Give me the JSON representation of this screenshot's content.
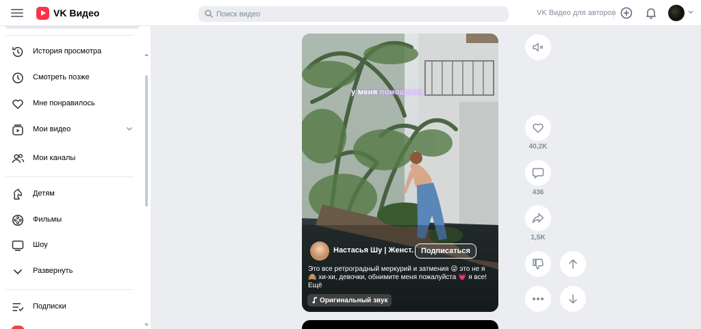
{
  "header": {
    "logo_text": "VK Видео",
    "search_placeholder": "Поиск видео",
    "for_authors": "VK Видео для авторов"
  },
  "sidebar": {
    "items": [
      {
        "label": "История просмотра",
        "icon": "history-icon"
      },
      {
        "label": "Смотреть позже",
        "icon": "clock-icon"
      },
      {
        "label": "Мне понравилось",
        "icon": "heart-icon"
      },
      {
        "label": "Мои видео",
        "icon": "my-videos-icon"
      },
      {
        "label": "Мои каналы",
        "icon": "users-icon"
      },
      {
        "label": "Детям",
        "icon": "horse-icon"
      },
      {
        "label": "Фильмы",
        "icon": "film-reel-icon"
      },
      {
        "label": "Шоу",
        "icon": "tv-icon"
      },
      {
        "label": "Развернуть",
        "icon": "chevron-down-icon"
      },
      {
        "label": "Подписки",
        "icon": "subscriptions-icon"
      }
    ]
  },
  "video": {
    "overlay_text_start": "у меня ",
    "overlay_text_highlight": "помощники",
    "author_name": "Настасья Шу | Женст...",
    "subscribe_label": "Подписаться",
    "description_lines": [
      "Это все ретроградный меркурий и затмения 😜 это не я",
      "🙈 хи-хи, девочки, обнимите меня пожалуйста 💗 я все!"
    ],
    "more_label": "Ещё",
    "sound_label": "Оригинальный звук"
  },
  "actions": {
    "likes": "40,2K",
    "comments": "436",
    "shares": "1,5K"
  },
  "colors": {
    "brand": "#ff3347",
    "page_bg": "#ebedf0",
    "muted_text": "#818c99"
  }
}
